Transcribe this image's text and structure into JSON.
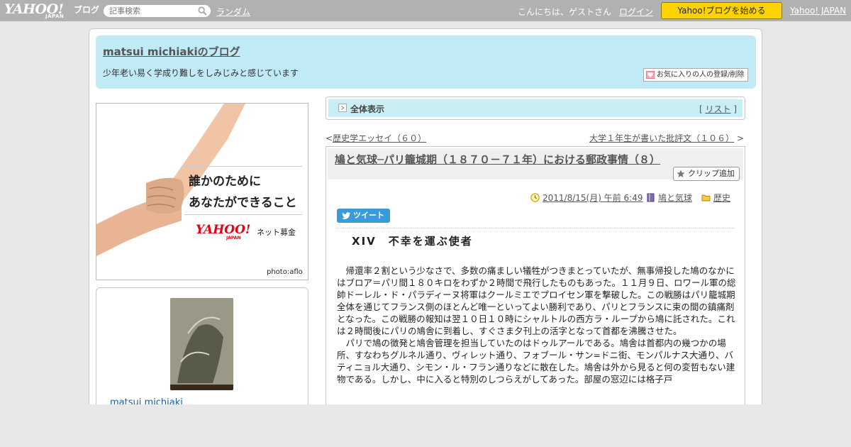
{
  "topbar": {
    "logo_main": "YAHOO!",
    "logo_sub": "JAPAN",
    "logo_blog": "ブログ",
    "search_placeholder": "記事検索",
    "random_label": "ランダム",
    "greeting": "こんにちは、ゲストさん",
    "login_label": "ログイン",
    "start_button": "Yahoo!ブログを始める",
    "yahoo_japan_link": "Yahoo! JAPAN"
  },
  "blog": {
    "title": "matsui michiakiのブログ",
    "description": "少年老い易く学成り難しをしみじみと感じています",
    "favorite_button": "お気に入りの人の登録/削除"
  },
  "banner": {
    "line1": "誰かのために",
    "line2": "あなたができること",
    "logo_main": "YAHOO!",
    "logo_sub": "JAPAN",
    "tagline": "ネット募金",
    "credit": "photo:aflo"
  },
  "profile": {
    "name": "matsui michiaki"
  },
  "nav": {
    "title": "全体表示",
    "list_open": "[",
    "list_label": "リスト",
    "list_close": "]"
  },
  "pager": {
    "prev_arrow": "<",
    "prev_label": "歴史学エッセイ（６０）",
    "next_label": "大学１年生が書いた批評文（１０６）",
    "next_arrow": ">"
  },
  "article": {
    "title": "鳩と気球─パリ籠城期（１８７０－７１年）における郵政事情（８）",
    "clip_button": "クリップ追加",
    "date": "2011/8/15(月) 午前 6:49",
    "category": "鳩と気球",
    "folder": "歴史",
    "tweet_label": "ツイート",
    "section_heading": "XIV　不幸を運ぶ使者",
    "paragraph1": "帰還率２割という少なさで、多数の痛ましい犠牲がつきまとっていたが、無事帰投した鳩のなかにはブロア＝パリ間１８０キロをわずか２時間で飛行したものもあった。１１月９日、ロワール軍の総帥ドーレル・ド・パラディーヌ将軍はクールミエでプロイセン軍を撃破した。この戦勝はパリ籠城期全体を通じてフランス側のほとんど唯一といってよい勝利であり、パリとフランスに束の間の鎮痛剤となった。この戦勝の報知は翌１０日１０時にシャルトルの西方ラ・ループから鳩に託された。これは２時間後にパリの鳩舎に到着し、すぐさま夕刊上の活字となって首都を沸騰させた。",
    "paragraph2": "パリで鳩の徴発と鳩舎管理を担当していたのはドゥルアールである。鳩舎は首都内の幾つかの場所、すなわちグルネル通り、ヴィレット通り、フォブール・サン=ドニ街、モンパルナス大通り、バティニョル大通り、シモン・ル・フラン通りなどに散在した。鳩舎は外から見ると何の変哲もない建物である。しかし、中に入ると特別のしつらえがしてあった。部屋の窓辺には格子戸"
  },
  "colors": {
    "topbar_bg": "#b1b1b1",
    "header_bg": "#bfeaf6",
    "nav_bg": "#c9eff4",
    "start_button_bg": "#ffd300",
    "tweet_bg": "#3b9bd9"
  }
}
